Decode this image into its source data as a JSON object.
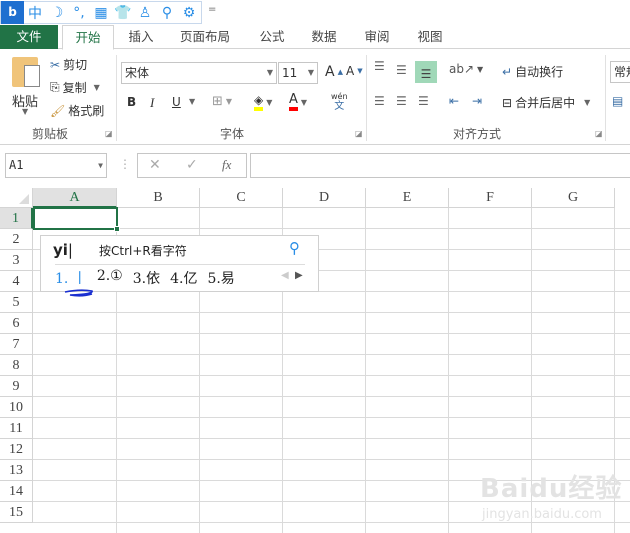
{
  "quick_access": {
    "icons": [
      "ime-logo-icon",
      "chinese-mode-icon",
      "half-width-moon-icon",
      "punctuation-icon",
      "soft-keyboard-icon",
      "skin-shirt-icon",
      "user-icon",
      "search-icon",
      "settings-gear-icon"
    ],
    "chinese_label": "中",
    "more_label": "="
  },
  "tabs": [
    {
      "label": "文件"
    },
    {
      "label": "开始"
    },
    {
      "label": "插入"
    },
    {
      "label": "页面布局"
    },
    {
      "label": "公式"
    },
    {
      "label": "数据"
    },
    {
      "label": "审阅"
    },
    {
      "label": "视图"
    }
  ],
  "ribbon": {
    "clipboard": {
      "paste": "粘贴",
      "cut": "剪切",
      "copy": "复制",
      "format_painter": "格式刷",
      "group": "剪贴板"
    },
    "font": {
      "name": "宋体",
      "size": "11",
      "bold": "B",
      "italic": "I",
      "underline": "U",
      "font_color_label": "A",
      "phonetic_top": "wén",
      "phonetic_bottom": "文",
      "group": "字体",
      "highlight_color": "#ffff00",
      "font_color": "#ff0000"
    },
    "alignment": {
      "wrap_text": "自动换行",
      "merge_center": "合并后居中",
      "group": "对齐方式"
    },
    "number": {
      "format": "常规"
    }
  },
  "formula_bar": {
    "name_box": "A1",
    "fx": "fx",
    "cancel": "✕",
    "enter": "✓"
  },
  "columns": [
    "A",
    "B",
    "C",
    "D",
    "E",
    "F",
    "G"
  ],
  "rows": [
    "1",
    "2",
    "3",
    "4",
    "5",
    "6",
    "7",
    "8",
    "9",
    "10",
    "11",
    "12",
    "13",
    "14",
    "15"
  ],
  "selected_cell": "A1",
  "ime": {
    "input": "yi",
    "hint": "按Ctrl+R看字符",
    "candidates": [
      "1. 丨",
      "2.①",
      "3.依",
      "4.亿",
      "5.易"
    ]
  },
  "watermark": {
    "text": "Baidu经验",
    "url_text": "jingyan.baidu.com"
  },
  "accent": "#217346"
}
